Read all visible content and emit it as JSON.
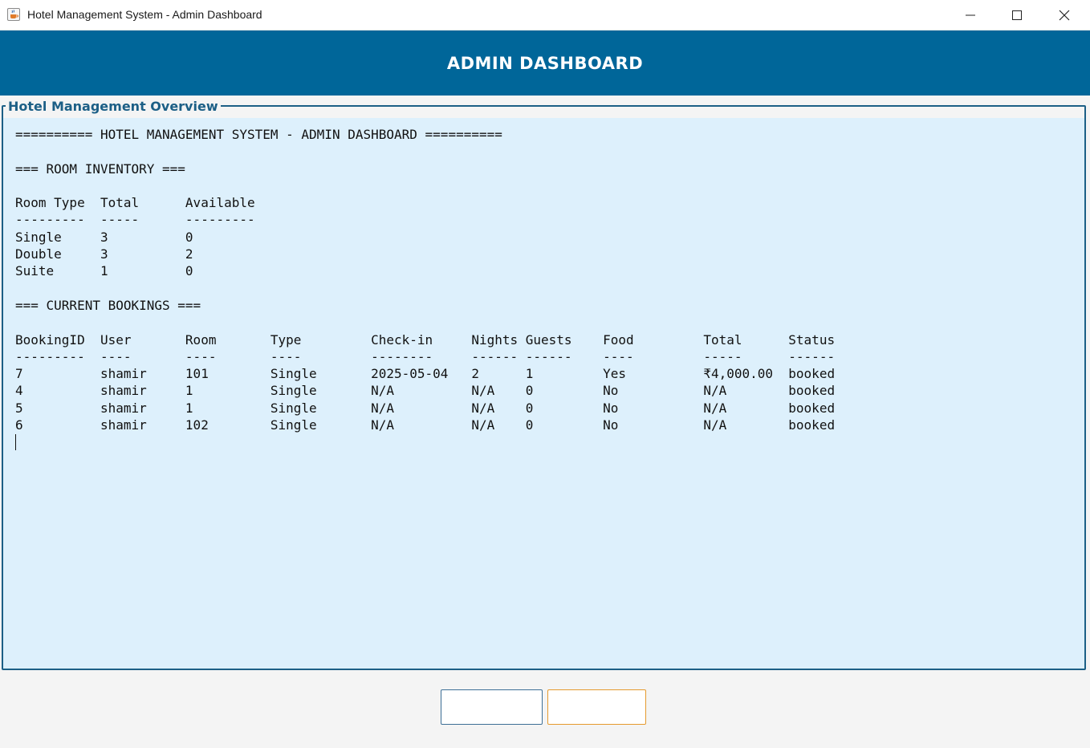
{
  "window": {
    "title": "Hotel Management System - Admin Dashboard",
    "icon": "java-cup-icon"
  },
  "header": {
    "title": "ADMIN DASHBOARD"
  },
  "panel": {
    "legend": "Hotel Management Overview",
    "lines": [
      "========== HOTEL MANAGEMENT SYSTEM - ADMIN DASHBOARD ==========",
      "",
      "=== ROOM INVENTORY ===",
      "",
      "Room Type  Total      Available",
      "---------  -----      ---------",
      "Single     3          0",
      "Double     3          2",
      "Suite      1          0",
      "",
      "=== CURRENT BOOKINGS ===",
      "",
      "BookingID  User       Room       Type         Check-in     Nights Guests    Food         Total      Status",
      "---------  ----       ----       ----         --------     ------ ------    ----         -----      ------",
      "7          shamir     101        Single       2025-05-04   2      1         Yes          ₹4,000.00  booked",
      "4          shamir     1          Single       N/A          N/A    0         No           N/A        booked",
      "5          shamir     1          Single       N/A          N/A    0         No           N/A        booked",
      "6          shamir     102        Single       N/A          N/A    0         No           N/A        booked"
    ]
  },
  "buttons": {
    "refresh_label": "",
    "logout_label": ""
  },
  "colors": {
    "header_bg": "#006699",
    "text_area_bg": "#ddf0fc",
    "panel_border": "#1c5f86",
    "refresh_border": "#3d6f96",
    "logout_border": "#e59a2e"
  }
}
